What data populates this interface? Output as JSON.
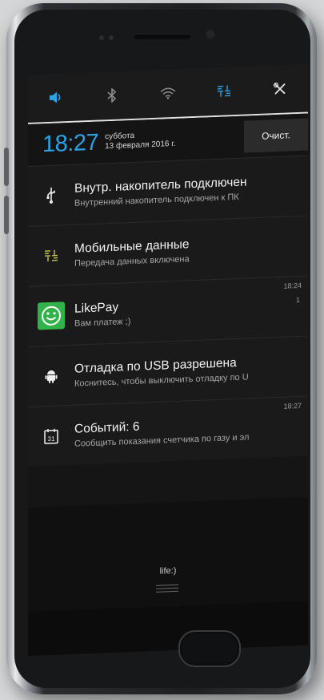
{
  "quick_settings": {
    "toggles": [
      {
        "name": "sound",
        "glyph": "🔊",
        "state": "on"
      },
      {
        "name": "bluetooth",
        "glyph": "ᛒ",
        "state": "off"
      },
      {
        "name": "wifi",
        "glyph": "wifi",
        "state": "off"
      },
      {
        "name": "mobile-data",
        "glyph": "data",
        "state": "on"
      },
      {
        "name": "settings",
        "glyph": "✕",
        "state": "tool"
      }
    ],
    "accent_color": "#2aa4e7"
  },
  "status": {
    "time": "18:27",
    "weekday": "суббота",
    "date": "13 февраля 2016 г.",
    "clear_label": "Очист."
  },
  "notifications": [
    {
      "icon": "usb-icon",
      "title": "Внутр. накопитель подключен",
      "text": "Внутренний накопитель подключен к ПК",
      "time": "",
      "count": ""
    },
    {
      "icon": "mobile-data-icon",
      "title": "Мобильные данные",
      "text": "Передача данных включена",
      "time": "",
      "count": ""
    },
    {
      "icon": "likepay-icon",
      "title": "LikePay",
      "text": "Вам платеж ;)",
      "time": "18:24",
      "count": "1"
    },
    {
      "icon": "android-icon",
      "title": "Отладка по USB разрешена",
      "text": "Коснитесь, чтобы выключить отладку по U",
      "time": "",
      "count": ""
    },
    {
      "icon": "calendar-icon",
      "title": "Событий: 6",
      "text": "Сообщить показания счетчика по газу и эл",
      "time": "18:27",
      "count": ""
    }
  ],
  "carrier": "life:)",
  "calendar_day": "31"
}
